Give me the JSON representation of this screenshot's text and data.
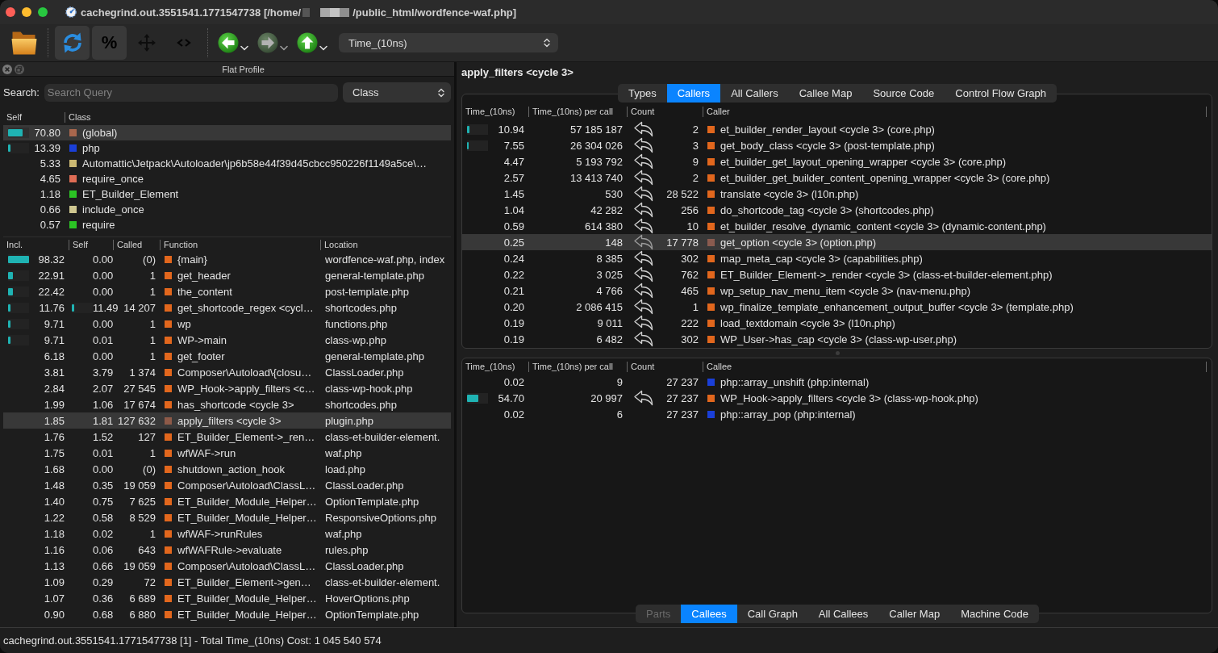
{
  "window": {
    "title_prefix": "cachegrind.out.3551541.1771547738 [/home/",
    "title_suffix": "/public_html/wordfence-waf.php]"
  },
  "toolbar": {
    "buttons": [
      [
        {
          "kind": "open",
          "on": false
        }
      ],
      [
        {
          "kind": "reload",
          "on": true
        },
        {
          "kind": "percent",
          "label": "%",
          "on": true
        },
        {
          "kind": "move",
          "on": false
        },
        {
          "kind": "code",
          "on": false
        }
      ]
    ],
    "navigation": [
      {
        "kind": "back",
        "disabled": false
      },
      {
        "kind": "forward",
        "disabled": true
      },
      {
        "kind": "up",
        "disabled": false
      }
    ],
    "cost_type": "Time_(10ns)"
  },
  "flat_profile": {
    "title": "Flat Profile",
    "search": {
      "label": "Search:",
      "placeholder": "Search Query"
    },
    "group_by": "Class",
    "class_table": {
      "columns": [
        "Self",
        "Class"
      ],
      "rows": [
        {
          "self": "70.80",
          "bar": {
            "level": 0.708
          },
          "name": "(global)",
          "color": "#a9674d",
          "selected": true
        },
        {
          "self": "13.39",
          "bar": {
            "level": 0.1339
          },
          "name": "php",
          "color": "#1a3fd8",
          "selected": false
        },
        {
          "self": "5.33",
          "name": "Automattic\\Jetpack\\Autoloader\\jp6b58e44f39d45cbcc950226f1149a5ce\\…",
          "color": "#cbb872",
          "selected": false
        },
        {
          "self": "4.65",
          "name": "require_once",
          "color": "#df6d55",
          "selected": false
        },
        {
          "self": "1.18",
          "name": "ET_Builder_Element",
          "color": "#2bc424",
          "selected": false
        },
        {
          "self": "0.66",
          "name": "include_once",
          "color": "#cfc790",
          "selected": false
        },
        {
          "self": "0.57",
          "name": "require",
          "color": "#2bc424",
          "selected": false
        }
      ]
    },
    "function_table": {
      "columns": [
        "Incl.",
        "Self",
        "Called",
        "Function",
        "Location"
      ],
      "rows": [
        {
          "incl": "98.32",
          "incl_bar": {
            "level": 0.9832
          },
          "self": "0.00",
          "called": "(0)",
          "name": "{main}",
          "color": "#e2671d",
          "location": "wordfence-waf.php, index",
          "selected": false
        },
        {
          "incl": "22.91",
          "incl_bar": {
            "level": 0.2291
          },
          "self": "0.00",
          "called": "1",
          "name": "get_header",
          "color": "#e2671d",
          "location": "general-template.php",
          "selected": false
        },
        {
          "incl": "22.42",
          "incl_bar": {
            "level": 0.2242
          },
          "self": "0.00",
          "called": "1",
          "name": "the_content",
          "color": "#e2671d",
          "location": "post-template.php",
          "selected": false
        },
        {
          "incl": "11.76",
          "incl_bar": {
            "level": 0.1176
          },
          "self": "11.49",
          "self_bar": {
            "level": 0.1149
          },
          "called": "14 207",
          "name": "get_shortcode_regex <cycl…",
          "color": "#e2671d",
          "location": "shortcodes.php",
          "selected": false
        },
        {
          "incl": "9.71",
          "incl_bar": {
            "level": 0.0971
          },
          "self": "0.00",
          "called": "1",
          "name": "wp",
          "color": "#e2671d",
          "location": "functions.php",
          "selected": false
        },
        {
          "incl": "9.71",
          "incl_bar": {
            "level": 0.0971
          },
          "self": "0.01",
          "called": "1",
          "name": "WP->main",
          "color": "#e2671d",
          "location": "class-wp.php",
          "selected": false
        },
        {
          "incl": "6.18",
          "self": "0.00",
          "called": "1",
          "name": "get_footer",
          "color": "#e2671d",
          "location": "general-template.php",
          "selected": false
        },
        {
          "incl": "3.81",
          "self": "3.79",
          "called": "1 374",
          "name": "Composer\\Autoload\\{closu…",
          "color": "#e2671d",
          "location": "ClassLoader.php",
          "selected": false
        },
        {
          "incl": "2.84",
          "self": "2.07",
          "called": "27 545",
          "name": "WP_Hook->apply_filters <c…",
          "color": "#e2671d",
          "location": "class-wp-hook.php",
          "selected": false
        },
        {
          "incl": "1.99",
          "self": "1.06",
          "called": "17 674",
          "name": "has_shortcode <cycle 3>",
          "color": "#e2671d",
          "location": "shortcodes.php",
          "selected": false
        },
        {
          "incl": "1.85",
          "self": "1.81",
          "called": "127 632",
          "name": "apply_filters <cycle 3>",
          "color": "#8e5a48",
          "location": "plugin.php",
          "selected": true
        },
        {
          "incl": "1.76",
          "self": "1.52",
          "called": "127",
          "name": "ET_Builder_Element->_ren…",
          "color": "#e2671d",
          "location": "class-et-builder-element.",
          "selected": false
        },
        {
          "incl": "1.75",
          "self": "0.01",
          "called": "1",
          "name": "wfWAF->run",
          "color": "#e2671d",
          "location": "waf.php",
          "selected": false
        },
        {
          "incl": "1.68",
          "self": "0.00",
          "called": "(0)",
          "name": "shutdown_action_hook",
          "color": "#e2671d",
          "location": "load.php",
          "selected": false
        },
        {
          "incl": "1.48",
          "self": "0.35",
          "called": "19 059",
          "name": "Composer\\Autoload\\ClassL…",
          "color": "#e2671d",
          "location": "ClassLoader.php",
          "selected": false
        },
        {
          "incl": "1.40",
          "self": "0.75",
          "called": "7 625",
          "name": "ET_Builder_Module_Helper…",
          "color": "#e2671d",
          "location": "OptionTemplate.php",
          "selected": false
        },
        {
          "incl": "1.22",
          "self": "0.58",
          "called": "8 529",
          "name": "ET_Builder_Module_Helper…",
          "color": "#e2671d",
          "location": "ResponsiveOptions.php",
          "selected": false
        },
        {
          "incl": "1.18",
          "self": "0.02",
          "called": "1",
          "name": "wfWAF->runRules",
          "color": "#e2671d",
          "location": "waf.php",
          "selected": false
        },
        {
          "incl": "1.16",
          "self": "0.06",
          "called": "643",
          "name": "wfWAFRule->evaluate",
          "color": "#e2671d",
          "location": "rules.php",
          "selected": false
        },
        {
          "incl": "1.13",
          "self": "0.66",
          "called": "19 059",
          "name": "Composer\\Autoload\\ClassL…",
          "color": "#e2671d",
          "location": "ClassLoader.php",
          "selected": false
        },
        {
          "incl": "1.09",
          "self": "0.29",
          "called": "72",
          "name": "ET_Builder_Element->gen…",
          "color": "#e2671d",
          "location": "class-et-builder-element.",
          "selected": false
        },
        {
          "incl": "1.07",
          "self": "0.36",
          "called": "6 689",
          "name": "ET_Builder_Module_Helper…",
          "color": "#e2671d",
          "location": "HoverOptions.php",
          "selected": false
        },
        {
          "incl": "0.90",
          "self": "0.68",
          "called": "6 880",
          "name": "ET_Builder_Module_Helper…",
          "color": "#e2671d",
          "location": "OptionTemplate.php",
          "selected": false
        }
      ]
    }
  },
  "right_panel": {
    "title": "apply_filters <cycle 3>",
    "tabs_top": [
      {
        "label": "Types",
        "selected": false
      },
      {
        "label": "Callers",
        "selected": true
      },
      {
        "label": "All Callers",
        "selected": false
      },
      {
        "label": "Callee Map",
        "selected": false
      },
      {
        "label": "Source Code",
        "selected": false
      },
      {
        "label": "Control Flow Graph",
        "selected": false
      }
    ],
    "callers": {
      "columns": [
        "Time_(10ns)",
        "Time_(10ns) per call",
        "Count",
        "Caller"
      ],
      "rows": [
        {
          "time": "10.94",
          "bar": {
            "level": 0.1094
          },
          "per_call": "57 185 187",
          "cycle_arrow": true,
          "count": "2",
          "name": "et_builder_render_layout <cycle 3> (core.php)",
          "color": "#e2671d",
          "selected": false
        },
        {
          "time": "7.55",
          "bar": {
            "level": 0.0755
          },
          "per_call": "26 304 026",
          "cycle_arrow": true,
          "count": "3",
          "name": "get_body_class <cycle 3> (post-template.php)",
          "color": "#e2671d",
          "selected": false
        },
        {
          "time": "4.47",
          "per_call": "5 193 792",
          "cycle_arrow": true,
          "count": "9",
          "name": "et_builder_get_layout_opening_wrapper <cycle 3> (core.php)",
          "color": "#e2671d",
          "selected": false
        },
        {
          "time": "2.57",
          "per_call": "13 413 740",
          "cycle_arrow": true,
          "count": "2",
          "name": "et_builder_get_builder_content_opening_wrapper <cycle 3> (core.php)",
          "color": "#e2671d",
          "selected": false
        },
        {
          "time": "1.45",
          "per_call": "530",
          "cycle_arrow": true,
          "count": "28 522",
          "name": "translate <cycle 3> (l10n.php)",
          "color": "#e2671d",
          "selected": false
        },
        {
          "time": "1.04",
          "per_call": "42 282",
          "cycle_arrow": true,
          "count": "256",
          "name": "do_shortcode_tag <cycle 3> (shortcodes.php)",
          "color": "#e2671d",
          "selected": false
        },
        {
          "time": "0.59",
          "per_call": "614 380",
          "cycle_arrow": true,
          "count": "10",
          "name": "et_builder_resolve_dynamic_content <cycle 3> (dynamic-content.php)",
          "color": "#e2671d",
          "selected": false
        },
        {
          "time": "0.25",
          "per_call": "148",
          "cycle_arrow": true,
          "count": "17 778",
          "name": "get_option <cycle 3> (option.php)",
          "color": "#8a5b4f",
          "selected": true
        },
        {
          "time": "0.24",
          "per_call": "8 385",
          "cycle_arrow": true,
          "count": "302",
          "name": "map_meta_cap <cycle 3> (capabilities.php)",
          "color": "#e2671d",
          "selected": false
        },
        {
          "time": "0.22",
          "per_call": "3 025",
          "cycle_arrow": true,
          "count": "762",
          "name": "ET_Builder_Element->_render <cycle 3> (class-et-builder-element.php)",
          "color": "#e2671d",
          "selected": false
        },
        {
          "time": "0.21",
          "per_call": "4 766",
          "cycle_arrow": true,
          "count": "465",
          "name": "wp_setup_nav_menu_item <cycle 3> (nav-menu.php)",
          "color": "#e2671d",
          "selected": false
        },
        {
          "time": "0.20",
          "per_call": "2 086 415",
          "cycle_arrow": true,
          "count": "1",
          "name": "wp_finalize_template_enhancement_output_buffer <cycle 3> (template.php)",
          "color": "#e2671d",
          "selected": false
        },
        {
          "time": "0.19",
          "per_call": "9 011",
          "cycle_arrow": true,
          "count": "222",
          "name": "load_textdomain <cycle 3> (l10n.php)",
          "color": "#e2671d",
          "selected": false
        },
        {
          "time": "0.19",
          "per_call": "6 482",
          "cycle_arrow": true,
          "count": "302",
          "name": "WP_User->has_cap <cycle 3> (class-wp-user.php)",
          "color": "#e2671d",
          "selected": false
        }
      ]
    },
    "callees": {
      "columns": [
        "Time_(10ns)",
        "Time_(10ns) per call",
        "Count",
        "Callee"
      ],
      "rows": [
        {
          "time": "0.02",
          "per_call": "9",
          "cycle_arrow": false,
          "count": "27 237",
          "name": "php::array_unshift (php:internal)",
          "color": "#1a3fd8",
          "selected": false
        },
        {
          "time": "54.70",
          "bar": {
            "level": 0.547
          },
          "per_call": "20 997",
          "cycle_arrow": true,
          "count": "27 237",
          "name": "WP_Hook->apply_filters <cycle 3> (class-wp-hook.php)",
          "color": "#e2671d",
          "selected": false
        },
        {
          "time": "0.02",
          "per_call": "6",
          "cycle_arrow": false,
          "count": "27 237",
          "name": "php::array_pop (php:internal)",
          "color": "#1a3fd8",
          "selected": false
        }
      ]
    },
    "tabs_bottom": [
      {
        "label": "Parts",
        "selected": false,
        "disabled": true
      },
      {
        "label": "Callees",
        "selected": true,
        "disabled": false
      },
      {
        "label": "Call Graph",
        "selected": false,
        "disabled": false
      },
      {
        "label": "All Callees",
        "selected": false,
        "disabled": false
      },
      {
        "label": "Caller Map",
        "selected": false,
        "disabled": false
      },
      {
        "label": "Machine Code",
        "selected": false,
        "disabled": false
      }
    ]
  },
  "status_bar": "cachegrind.out.3551541.1771547738 [1] - Total Time_(10ns) Cost: 1 045 540 574"
}
